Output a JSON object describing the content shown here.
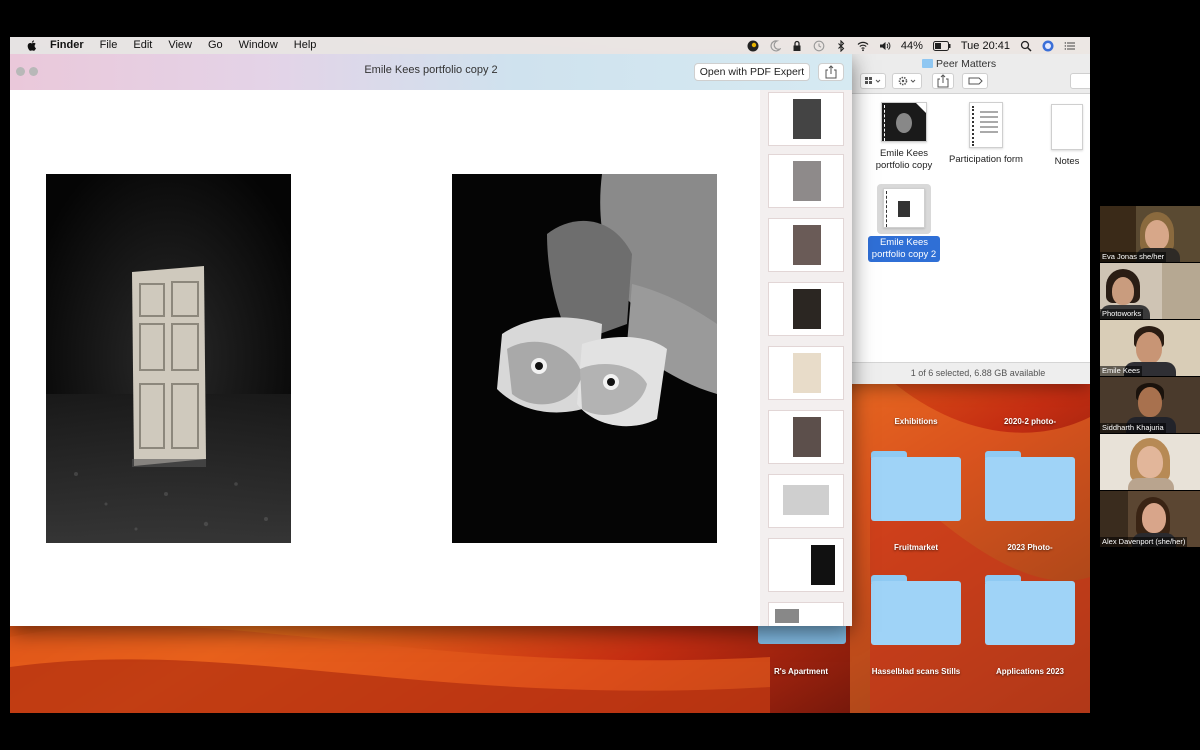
{
  "menubar": {
    "app": "Finder",
    "items": [
      "File",
      "Edit",
      "View",
      "Go",
      "Window",
      "Help"
    ],
    "battery": "44%",
    "clock": "Tue 20:41"
  },
  "preview": {
    "title": "Emile Kees portfolio copy 2",
    "open_with": "Open with PDF Expert"
  },
  "finder": {
    "title": "Peer Matters",
    "items": [
      {
        "label": "Emile Kees portfolio copy"
      },
      {
        "label": "Participation form"
      },
      {
        "label": "Notes"
      },
      {
        "label": "Emile Kees portfolio copy 2"
      }
    ],
    "status": "1 of 6 selected, 6.88 GB available"
  },
  "desktop": {
    "folders": [
      "Exhibitions",
      "2020-2 photo-",
      "Fruitmarket",
      "2023 Photo-",
      "R's Apartment",
      "Hasselblad scans Stills",
      "Applications 2023"
    ]
  },
  "participants": [
    {
      "name": "Eva Jonas she/her"
    },
    {
      "name": "Photoworks"
    },
    {
      "name": "Emile Kees"
    },
    {
      "name": "Siddharth Khajuria"
    },
    {
      "name": ""
    },
    {
      "name": "Alex Davenport (she/her)"
    }
  ],
  "colors": {
    "selection": "#2f6fd6",
    "folder": "#9fd3f7"
  }
}
